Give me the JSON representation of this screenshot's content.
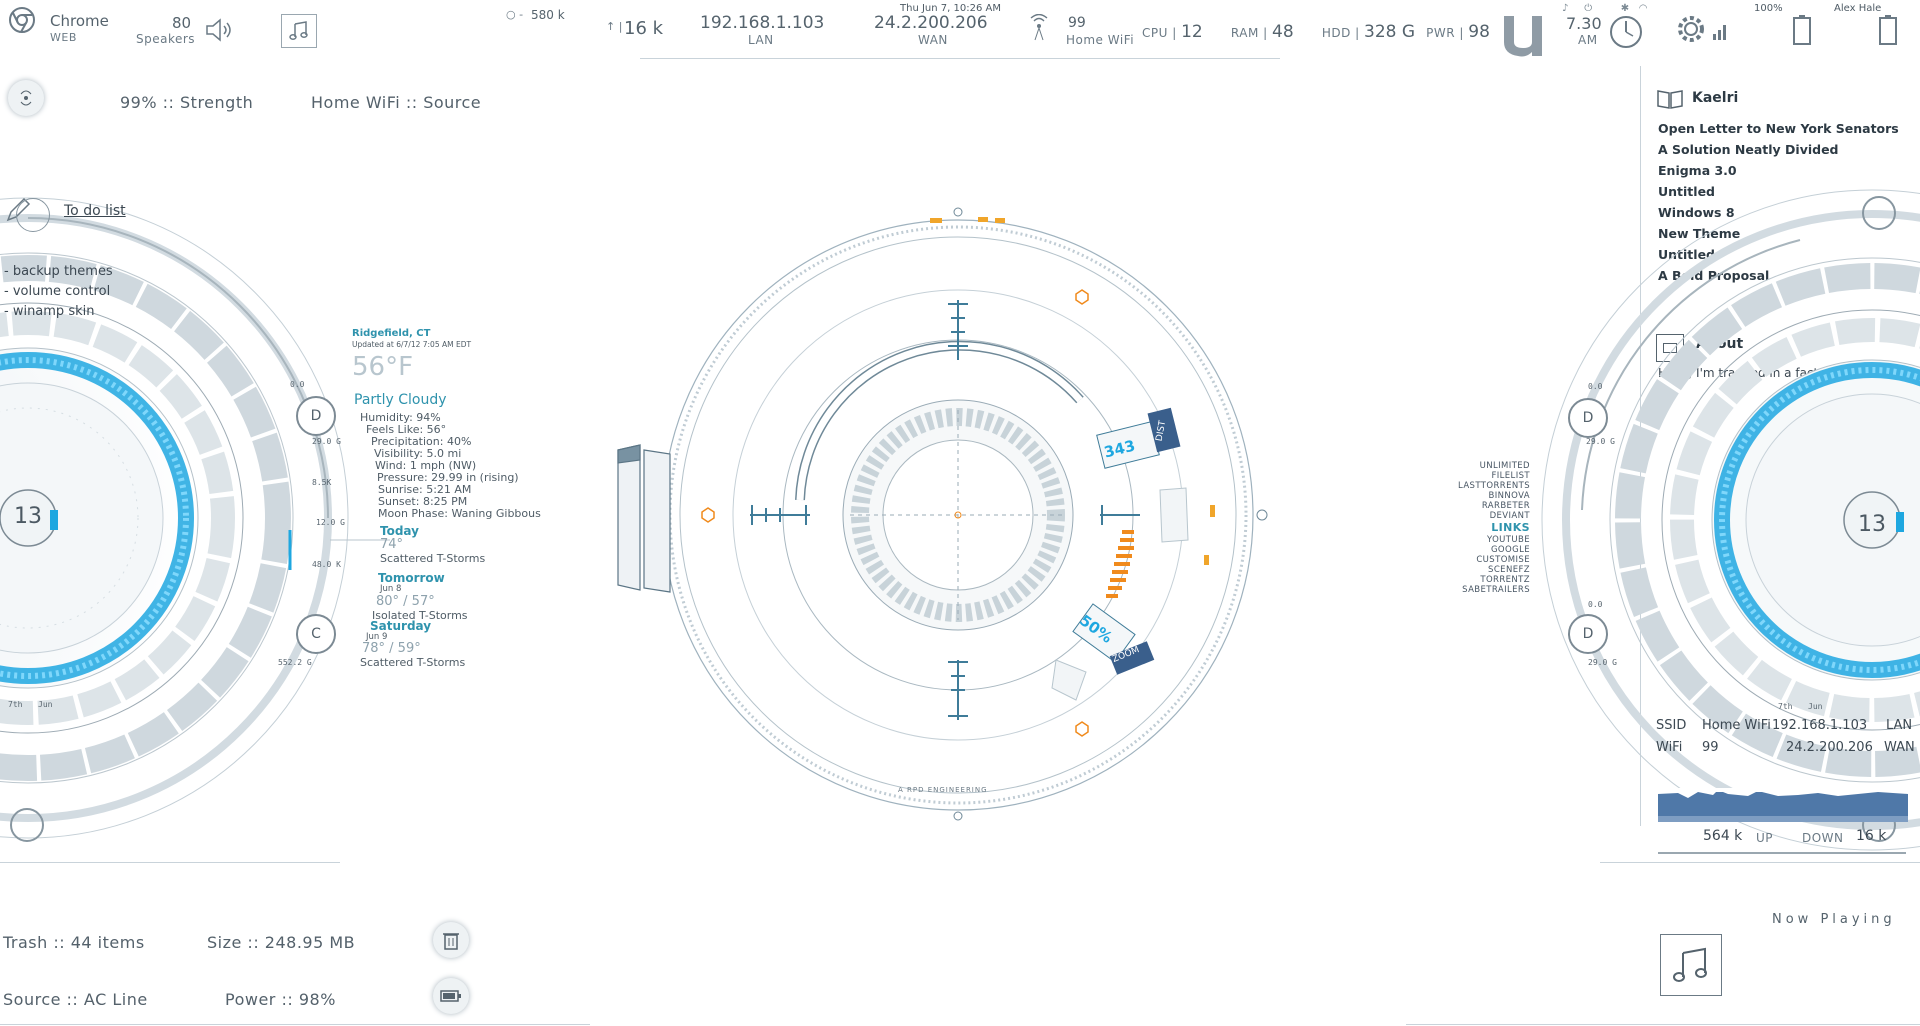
{
  "topbar": {
    "browser": {
      "name": "Chrome",
      "sub": "WEB"
    },
    "speakers": {
      "value": "80",
      "label": "Speakers"
    },
    "net_rate": "580 k",
    "up_rate": "16 k",
    "lan": {
      "ip": "192.168.1.103",
      "label": "LAN"
    },
    "wan": {
      "ip": "24.2.200.206",
      "label": "WAN"
    },
    "date": "Thu Jun 7, 10:26 AM",
    "wifi": {
      "value": "99",
      "label": "Home WiFi"
    },
    "cpu": {
      "label": "CPU",
      "value": "12"
    },
    "ram": {
      "label": "RAM",
      "value": "48"
    },
    "hdd": {
      "label": "HDD",
      "value": "328 G"
    },
    "pwr": {
      "label": "PWR",
      "value": "98"
    },
    "time": {
      "value": "7.30",
      "sub": "AM"
    },
    "battery_pct": "100% ",
    "user": "Alex Hale"
  },
  "wifi_panel": {
    "strength": "99% :: Strength",
    "source": "Home WiFi :: Source"
  },
  "todo": {
    "title": "To do list",
    "items": [
      "- backup themes",
      "- volume control",
      "- winamp skin"
    ]
  },
  "weather": {
    "location": "Ridgefield, CT",
    "updated": "Updated at 6/7/12 7:05 AM EDT",
    "temp": "56°F",
    "condition": "Partly Cloudy",
    "details": [
      "Humidity: 94%",
      "Feels Like: 56°",
      "Precipitation: 40%",
      "Visibility: 5.0 mi",
      "Wind: 1 mph (NW)",
      "Pressure: 29.99 in (rising)",
      "Sunrise: 5:21 AM",
      "Sunset: 8:25 PM",
      "Moon Phase: Waning Gibbous"
    ],
    "today": {
      "label": "Today",
      "temp": "74°",
      "cond": "Scattered T-Storms"
    },
    "tomorrow": {
      "label": "Tomorrow",
      "date": "Jun 8",
      "temp": "80° / 57°",
      "cond": "Isolated T-Storms"
    },
    "saturday": {
      "label": "Saturday",
      "date": "Jun 9",
      "temp": "78° / 59°",
      "cond": "Scattered T-Storms"
    }
  },
  "left_dial": {
    "center": "13",
    "d": "D",
    "c": "C",
    "vals": [
      "0.0",
      "29.0 G",
      "8.5K",
      "12.0 G",
      "48.0 K",
      "552.2 G"
    ],
    "month": "Jun",
    "day": "7th"
  },
  "right_dial": {
    "center": "13",
    "d": "D",
    "vals": [
      "0.0",
      "29.0 G",
      "0.0",
      "29.0 G"
    ],
    "month": "Jun",
    "day": "7th"
  },
  "center_hud": {
    "tag1": "DIST",
    "tag2": "ZOOM",
    "readout": "343",
    "readout2": "50%",
    "caption": "A RPD ENGINEERING"
  },
  "docs": {
    "title": "Kaelri",
    "items": [
      "Open Letter to New York Senators",
      "A Solution Neatly Divided",
      "Enigma 3.0",
      "Untitled",
      "Windows 8",
      "New Theme",
      "Untitled",
      "A Bold Proposal"
    ]
  },
  "about": {
    "title": "About",
    "text": "Hello, I'm trapped in a factory!"
  },
  "links": {
    "items": [
      "UNLIMITED",
      "FILELIST",
      "LASTTORRENTS",
      "BINNOVA",
      "RARBETER",
      "DEVIANT"
    ],
    "title": "LINKS",
    "items2": [
      "YOUTUBE",
      "GOOGLE",
      "CUSTOMISE",
      "SCENEFZ",
      "TORRENTZ",
      "SABETRAILERS"
    ]
  },
  "network_box": {
    "ssid_label": "SSID",
    "ssid": "Home WiFi",
    "ip1": "192.168.1.103",
    "lan": "LAN",
    "wifi_label": "WiFi",
    "wifi_val": "99",
    "ip2": "24.2.200.206",
    "wan": "WAN",
    "up": "564 k",
    "up_label": "UP",
    "down_label": "DOWN",
    "down": "16 k"
  },
  "now_playing": {
    "title": "Now Playing"
  },
  "bottom": {
    "trash": "Trash :: 44 items",
    "size": "Size :: 248.95 MB",
    "source": "Source :: AC Line",
    "power": "Power :: 98%"
  },
  "colors": {
    "accent": "#1ea7e0",
    "hud": "#5f8fa8",
    "orange": "#f08a1c",
    "navy": "#3a5f8c"
  }
}
